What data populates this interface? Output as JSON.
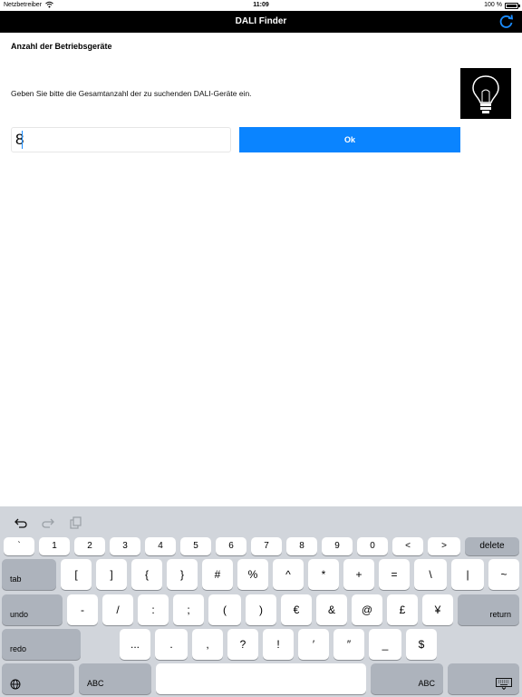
{
  "status_bar": {
    "carrier": "Netzbetreiber",
    "time": "11:09",
    "battery": "100 %"
  },
  "nav": {
    "title": "DALI Finder",
    "refresh_icon": "refresh-icon"
  },
  "form": {
    "section_title": "Anzahl der Betriebsgeräte",
    "instruction": "Geben Sie bitte die Gesamtanzahl der zu suchenden DALI-Geräte ein.",
    "count_value": "8",
    "ok_label": "Ok",
    "bulb_icon": "light-bulb-icon"
  },
  "keyboard": {
    "shortcuts": [
      "undo-icon",
      "redo-icon",
      "paste-icon"
    ],
    "row1": [
      "`",
      "1",
      "2",
      "3",
      "4",
      "5",
      "6",
      "7",
      "8",
      "9",
      "0",
      "<",
      ">"
    ],
    "row1_delete": "delete",
    "row2_tab": "tab",
    "row2": [
      "[",
      "]",
      "{",
      "}",
      "#",
      "%",
      "^",
      "*",
      "+",
      "=",
      "\\",
      "|",
      "~"
    ],
    "row3_undo": "undo",
    "row3": [
      "-",
      "/",
      ":",
      ";",
      "(",
      ")",
      "€",
      "&",
      "@",
      "£",
      "¥"
    ],
    "row3_return": "return",
    "row4_redo": "redo",
    "row4": [
      "...",
      ".",
      ",",
      "?",
      "!",
      "′",
      "″",
      "_",
      "$"
    ],
    "row5_globe": "globe-icon",
    "row5_abc_left": "ABC",
    "row5_abc_right": "ABC",
    "row5_hide": "keyboard-dismiss-icon"
  }
}
